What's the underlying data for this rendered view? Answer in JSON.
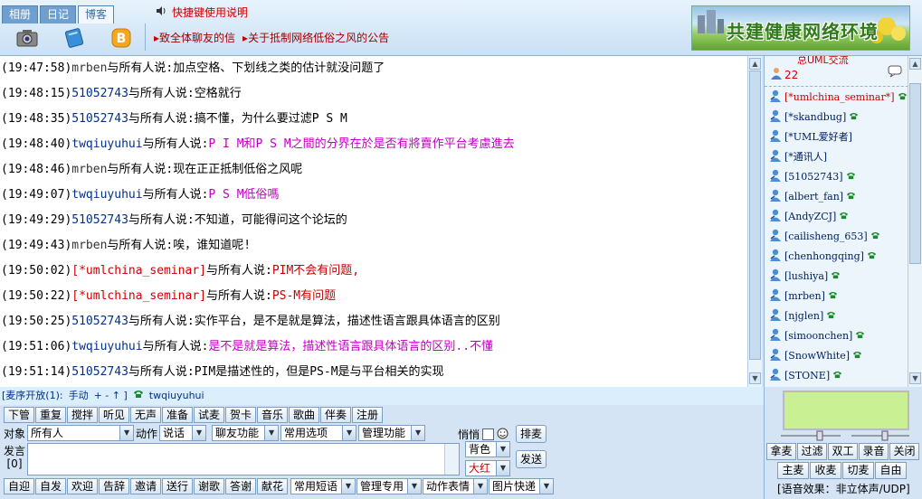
{
  "topbar": {
    "tabs": [
      {
        "label": "相册"
      },
      {
        "label": "日记"
      },
      {
        "label": "博客"
      }
    ],
    "tab_icons": [
      "camera-icon",
      "notebook-icon",
      "blog-icon"
    ],
    "shortcut_label": "快捷键使用说明",
    "notices": [
      "致全体聊友的信",
      "关于抵制网络低俗之风的公告"
    ],
    "banner_text": "共建健康网络环境"
  },
  "chat": {
    "messages": [
      {
        "time": "(19:47:58)",
        "speaker": "mrben",
        "mid": "与所有人说:",
        "text": "加点空格、下划线之类的估计就没问题了"
      },
      {
        "time": "(19:48:15)",
        "speaker": "51052743",
        "mid": "与所有人说:",
        "text": "空格就行"
      },
      {
        "time": "(19:48:35)",
        "speaker": "51052743",
        "mid": "与所有人说:",
        "text": "搞不懂，为什么要过滤P S M"
      },
      {
        "time": "(19:48:40)",
        "speaker": "twqiuyuhui",
        "mid": "与所有人说:",
        "text": "P I M和P S M之間的分界在於是否有將賣作平台考慮進去"
      },
      {
        "time": "(19:48:46)",
        "speaker": "mrben",
        "mid": "与所有人说:",
        "text": "现在正正抵制低俗之风呢"
      },
      {
        "time": "(19:49:07)",
        "speaker": "twqiuyuhui",
        "mid": "与所有人说:",
        "text": "P S M低俗嗎"
      },
      {
        "time": "(19:49:29)",
        "speaker": "51052743",
        "mid": "与所有人说:",
        "text": "不知道，可能得问这个论坛的"
      },
      {
        "time": "(19:49:43)",
        "speaker": "mrben",
        "mid": "与所有人说:",
        "text": "唉，谁知道呢!"
      },
      {
        "time": "(19:50:02)",
        "speaker": "[*umlchina_seminar]",
        "mid": "与所有人说:",
        "text": "PIM不会有问题,"
      },
      {
        "time": "(19:50:22)",
        "speaker": "[*umlchina_seminar]",
        "mid": "与所有人说:",
        "text": "PS-M有问题"
      },
      {
        "time": "(19:50:25)",
        "speaker": "51052743",
        "mid": "与所有人说:",
        "text": "实作平台，是不是就是算法，描述性语言跟具体语言的区别"
      },
      {
        "time": "(19:51:06)",
        "speaker": "twqiuyuhui",
        "mid": "与所有人说:",
        "text": "是不是就是算法，描述性语言跟具体语言的区别..不懂"
      },
      {
        "time": "(19:51:14)",
        "speaker": "51052743",
        "mid": "与所有人说:",
        "text": "PIM是描述性的，但是PS-M是与平台相关的实现"
      }
    ]
  },
  "userlist": {
    "header_title": "总UML交流",
    "count": "22",
    "users": [
      {
        "name": "[*umlchina_seminar*]",
        "red": true
      },
      {
        "name": "[*skandbug]"
      },
      {
        "name": "[*UML爱好者]"
      },
      {
        "name": "[*通讯人]"
      },
      {
        "name": "[51052743]"
      },
      {
        "name": "[albert_fan]"
      },
      {
        "name": "[AndyZCJ]"
      },
      {
        "name": "[cailisheng_653]"
      },
      {
        "name": "[chenhongqing]"
      },
      {
        "name": "[lushiya]"
      },
      {
        "name": "[mrben]"
      },
      {
        "name": "[njglen]"
      },
      {
        "name": "[simoonchen]"
      },
      {
        "name": "[SnowWhite]"
      },
      {
        "name": "[STONE]"
      }
    ]
  },
  "statusbar": {
    "queue_label": "[麦序开放(1):",
    "mode": "手动",
    "controls": "+ - ↑ ]",
    "speaker": "twqiuyuhui"
  },
  "controls": {
    "row1": [
      "下管",
      "重复",
      "搅拌",
      "听见",
      "无声",
      "准备",
      "试麦",
      "贺卡",
      "音乐",
      "歌曲",
      "伴奏",
      "注册"
    ],
    "target_label": "对象",
    "target_value": "所有人",
    "action_label": "动作",
    "action_value": "说话",
    "dropdowns": [
      "聊友功能",
      "常用选项",
      "管理功能"
    ],
    "quiet_label": "悄悄",
    "paimai": "排麦",
    "say_label": "发言",
    "say_count": "[0]",
    "bg_label": "背色",
    "size_label": "大红",
    "send": "发送",
    "row3": [
      "自迎",
      "自发",
      "欢迎",
      "告辞",
      "邀请",
      "送行",
      "谢歌",
      "答谢",
      "献花"
    ],
    "row3_dropdowns": [
      "常用短语",
      "管理专用",
      "动作表情",
      "图片快递"
    ]
  },
  "audio": {
    "buttons1": [
      "拿麦",
      "过滤",
      "双工",
      "录音",
      "关闭"
    ],
    "buttons2": [
      "主麦",
      "收麦",
      "切麦",
      "自由"
    ],
    "voice_effect": "[语音效果：非立体声/UDP]"
  }
}
